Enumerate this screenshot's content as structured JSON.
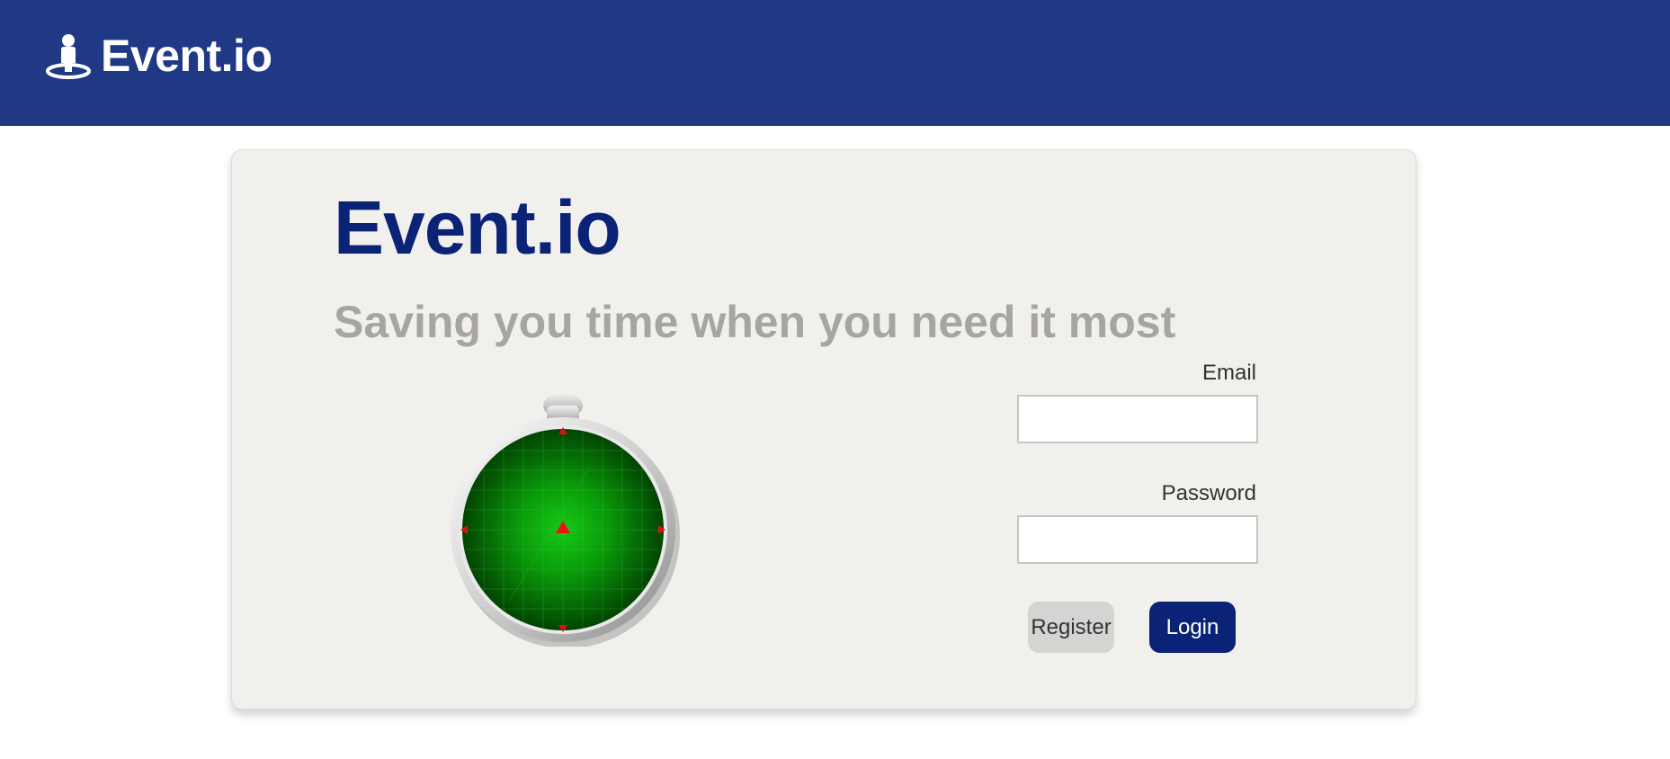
{
  "header": {
    "brand_icon": "person-location-icon",
    "brand_name": "Event.io"
  },
  "hero": {
    "title": "Event.io",
    "subtitle": "Saving you time when you need it most",
    "illustration": "radar-icon"
  },
  "login_form": {
    "email_label": "Email",
    "email_value": "",
    "password_label": "Password",
    "password_value": "",
    "register_label": "Register",
    "login_label": "Login"
  },
  "colors": {
    "header_bg": "#1f3984",
    "title": "#0a2376",
    "subtitle": "#a7a5a3",
    "card_bg": "#f2f0ed",
    "login_button": "#0a2376",
    "register_button": "#d6d4d2"
  }
}
